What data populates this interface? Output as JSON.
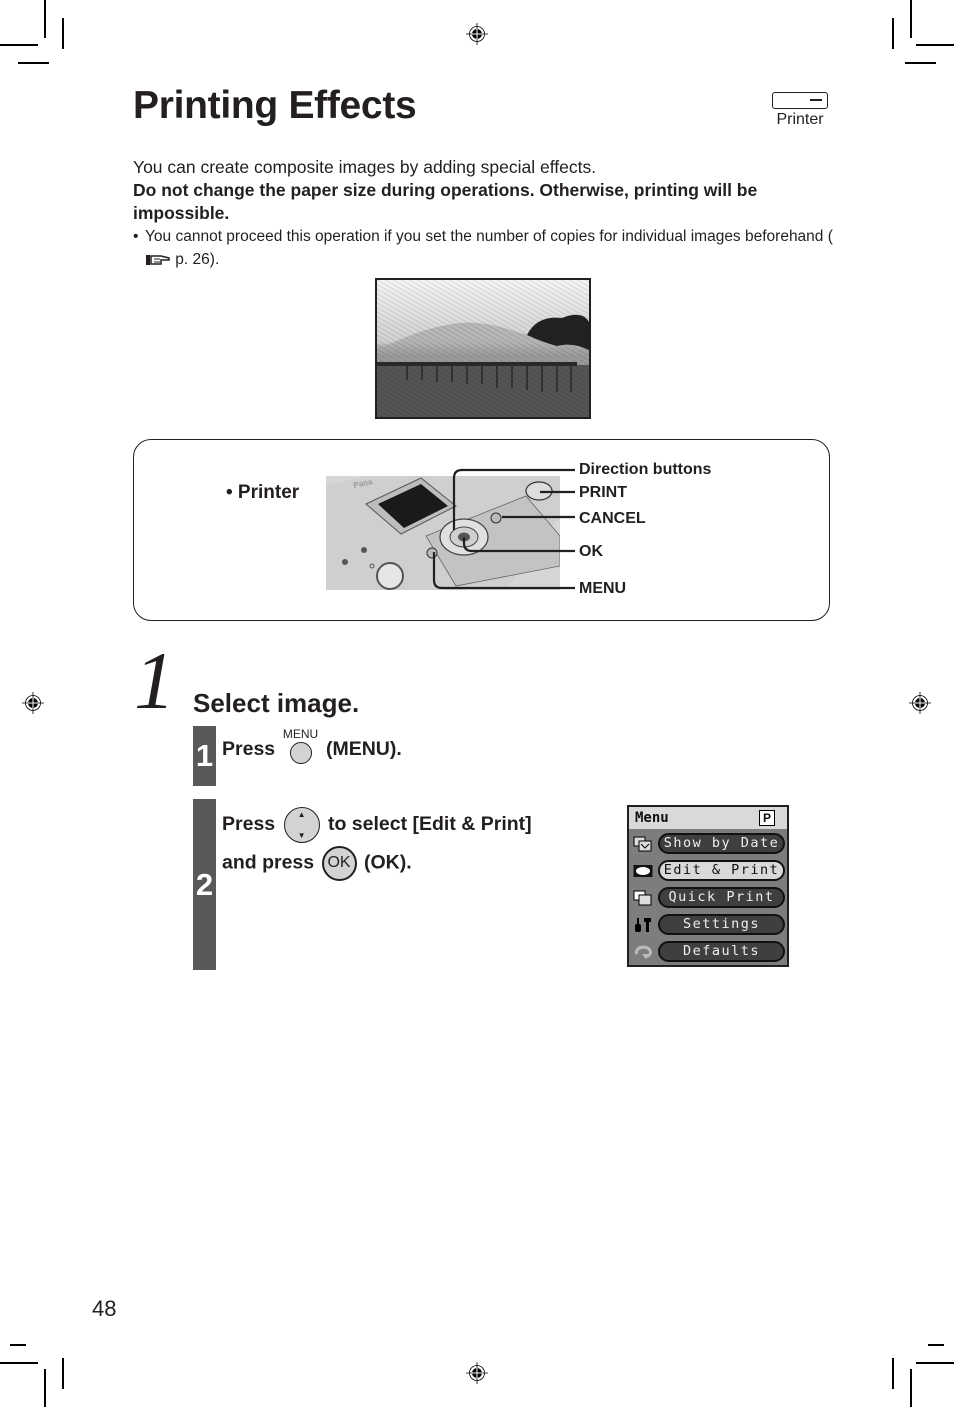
{
  "page": {
    "title": "Printing Effects",
    "device_tag": {
      "icon": "printer-icon",
      "label": "Printer"
    },
    "intro": "You can create composite images by adding special effects.",
    "warning": "Do not change the paper size during operations. Otherwise, printing will be impossible.",
    "note": {
      "bullet": "•",
      "text_before": "You cannot proceed this operation if you set the number of copies for individual images beforehand (",
      "ref_icon": "pointing-hand-icon",
      "text_after": " p. 26)."
    },
    "sample_image": {
      "description": "Pencil-sketch effect photo of a wooden bridge with mountain and pine tree"
    },
    "device_panel": {
      "label": "• Printer",
      "callouts": [
        "Direction buttons",
        "PRINT",
        "CANCEL",
        "OK",
        "MENU"
      ]
    },
    "page_number": "48"
  },
  "step1": {
    "number": "1",
    "title": "Select image.",
    "substeps": [
      {
        "number": "1",
        "press": "Press",
        "button_caption": "MENU",
        "suffix": "(MENU)."
      },
      {
        "number": "2",
        "press": "Press",
        "line1_suffix": "to select [Edit & Print]",
        "line2_prefix": "and press",
        "ok_label": "OK",
        "line2_suffix": "(OK)."
      }
    ]
  },
  "menu_screen": {
    "header": "Menu",
    "badge": "P",
    "items": [
      {
        "label": "Show by Date",
        "icon": "calendar-stack-icon",
        "selected": false
      },
      {
        "label": "Edit & Print",
        "icon": "edit-frame-icon",
        "selected": true
      },
      {
        "label": "Quick Print",
        "icon": "copies-icon",
        "selected": false
      },
      {
        "label": "Settings",
        "icon": "tools-icon",
        "selected": false
      },
      {
        "label": "Defaults",
        "icon": "reset-icon",
        "selected": false
      }
    ]
  }
}
